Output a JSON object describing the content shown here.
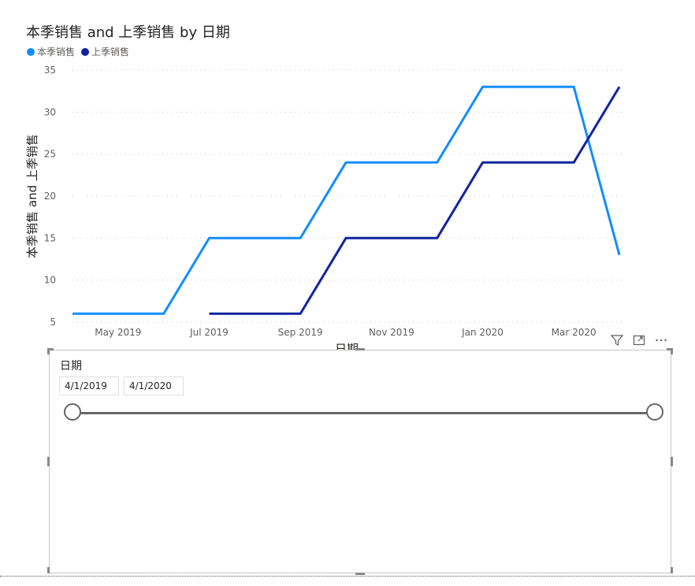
{
  "chart_data": {
    "type": "line",
    "title": "本季销售 and 上季销售 by 日期",
    "xlabel": "日期",
    "ylabel": "本季销售 and 上季销售",
    "ylim": [
      5,
      35
    ],
    "yticks": [
      5,
      10,
      15,
      20,
      25,
      30,
      35
    ],
    "xlim": [
      "2019-04",
      "2020-04"
    ],
    "xticks": [
      {
        "label": "May 2019",
        "x": "2019-05"
      },
      {
        "label": "Jul 2019",
        "x": "2019-07"
      },
      {
        "label": "Sep 2019",
        "x": "2019-09"
      },
      {
        "label": "Nov 2019",
        "x": "2019-11"
      },
      {
        "label": "Jan 2020",
        "x": "2020-01"
      },
      {
        "label": "Mar 2020",
        "x": "2020-03"
      }
    ],
    "grid": true,
    "legend_position": "top-left",
    "series": [
      {
        "name": "本季销售",
        "color": "#118DFF",
        "points": [
          {
            "x": "2019-04",
            "y": 6
          },
          {
            "x": "2019-05",
            "y": 6
          },
          {
            "x": "2019-06",
            "y": 6
          },
          {
            "x": "2019-07",
            "y": 15
          },
          {
            "x": "2019-08",
            "y": 15
          },
          {
            "x": "2019-09",
            "y": 15
          },
          {
            "x": "2019-10",
            "y": 24
          },
          {
            "x": "2019-11",
            "y": 24
          },
          {
            "x": "2019-12",
            "y": 24
          },
          {
            "x": "2020-01",
            "y": 33
          },
          {
            "x": "2020-02",
            "y": 33
          },
          {
            "x": "2020-03",
            "y": 33
          },
          {
            "x": "2020-04",
            "y": 13
          }
        ]
      },
      {
        "name": "上季销售",
        "color": "#12239E",
        "points": [
          {
            "x": "2019-07",
            "y": 6
          },
          {
            "x": "2019-08",
            "y": 6
          },
          {
            "x": "2019-09",
            "y": 6
          },
          {
            "x": "2019-10",
            "y": 15
          },
          {
            "x": "2019-11",
            "y": 15
          },
          {
            "x": "2019-12",
            "y": 15
          },
          {
            "x": "2020-01",
            "y": 24
          },
          {
            "x": "2020-02",
            "y": 24
          },
          {
            "x": "2020-03",
            "y": 24
          },
          {
            "x": "2020-04",
            "y": 33
          }
        ]
      }
    ]
  },
  "visual_icons": [
    "filter-icon",
    "focus-mode-icon",
    "more-options-icon"
  ],
  "slicer": {
    "title": "日期",
    "start_date": "4/1/2019",
    "end_date": "4/1/2020",
    "range_start": 0,
    "range_end": 1
  }
}
